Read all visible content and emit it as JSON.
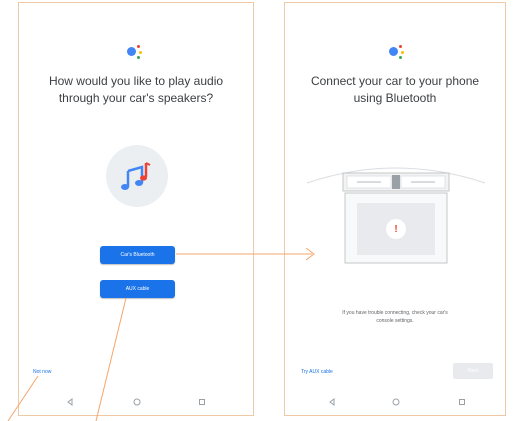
{
  "left_screen": {
    "title": "How would you like to play audio\nthrough your car's speakers?",
    "primary_button_label": "Car's Bluetooth",
    "secondary_button_label": "AUX cable",
    "link_label": "Not now"
  },
  "right_screen": {
    "title": "Connect your car to your phone\nusing Bluetooth",
    "hint": "If you have trouble connecting, check your car's\nconsole settings.",
    "link_label": "Try AUX cable",
    "next_label": "Next"
  },
  "icons": {
    "assistant": "google-assistant-icon",
    "music": "music-note-icon",
    "nav_back": "back-triangle-icon",
    "nav_home": "home-circle-icon",
    "nav_recents": "recents-square-icon",
    "car_console": "car-dashboard-illustration",
    "bluetooth_alert": "exclamation-icon"
  },
  "colors": {
    "accent": "#1a73e8",
    "annotation": "#f5a66b",
    "text": "#3c4043",
    "disabled": "#e8eaed"
  }
}
